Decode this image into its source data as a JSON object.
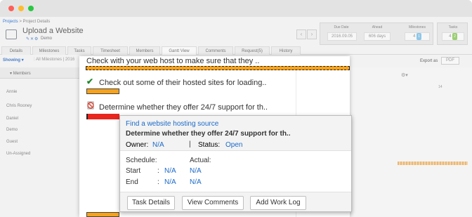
{
  "window": {
    "controls": [
      {
        "name": "close",
        "color": "#ff5f57"
      },
      {
        "name": "minimize",
        "color": "#febc2e"
      },
      {
        "name": "zoom",
        "color": "#28c840"
      }
    ]
  },
  "header": {
    "breadcrumb_link": "Projects",
    "breadcrumb_current": "> Project Details",
    "title": "Upload a Website",
    "subtitle": "Demo",
    "stats": [
      {
        "label": "Due Date",
        "value": "2016.09.05"
      },
      {
        "label": "Ahead",
        "value": "606 days"
      },
      {
        "label": "Milestones",
        "value": "4",
        "badge": "1"
      },
      {
        "label": "Tasks",
        "value": "4",
        "badge": "2"
      }
    ]
  },
  "tabs": [
    "Details",
    "Milestones",
    "Tasks",
    "Timesheet",
    "Members",
    "Gantt View",
    "Comments",
    "Request(5)",
    "History"
  ],
  "active_tab": "Gantt View",
  "toolbar": {
    "showing_label": "Showing",
    "filter_text": ": All Milestones | 2016",
    "export_label": "Export as",
    "pdf_label": "PDF"
  },
  "members": {
    "header": "Members",
    "list": [
      "Annie",
      "Chris Rooney",
      "Daniel",
      "Demo",
      "Guest",
      "Un-Assigned"
    ]
  },
  "gantt": {
    "day_label": "14",
    "tasks": [
      {
        "name": "Check with your web host to make sure that they ..",
        "status": "selected"
      },
      {
        "name": "Check out some of their hosted sites for loading..",
        "status": "done"
      },
      {
        "name": "Determine whether they offer 24/7 support for th..",
        "status": "overdue"
      }
    ]
  },
  "popup": {
    "milestone": "Find a website hosting source",
    "title": "Determine whether they offer 24/7 support for th..",
    "owner_label": "Owner:",
    "owner_value": "N/A",
    "separator": "|",
    "status_label": "Status:",
    "status_value": "Open",
    "schedule_label": "Schedule:",
    "actual_label": "Actual:",
    "start_label": "Start",
    "end_label": "End",
    "colon": ":",
    "schedule_start": "N/A",
    "schedule_end": "N/A",
    "actual_start": "N/A",
    "actual_end": "N/A",
    "buttons": {
      "task_details": "Task Details",
      "view_comments": "View Comments",
      "add_work_log": "Add Work Log"
    }
  }
}
